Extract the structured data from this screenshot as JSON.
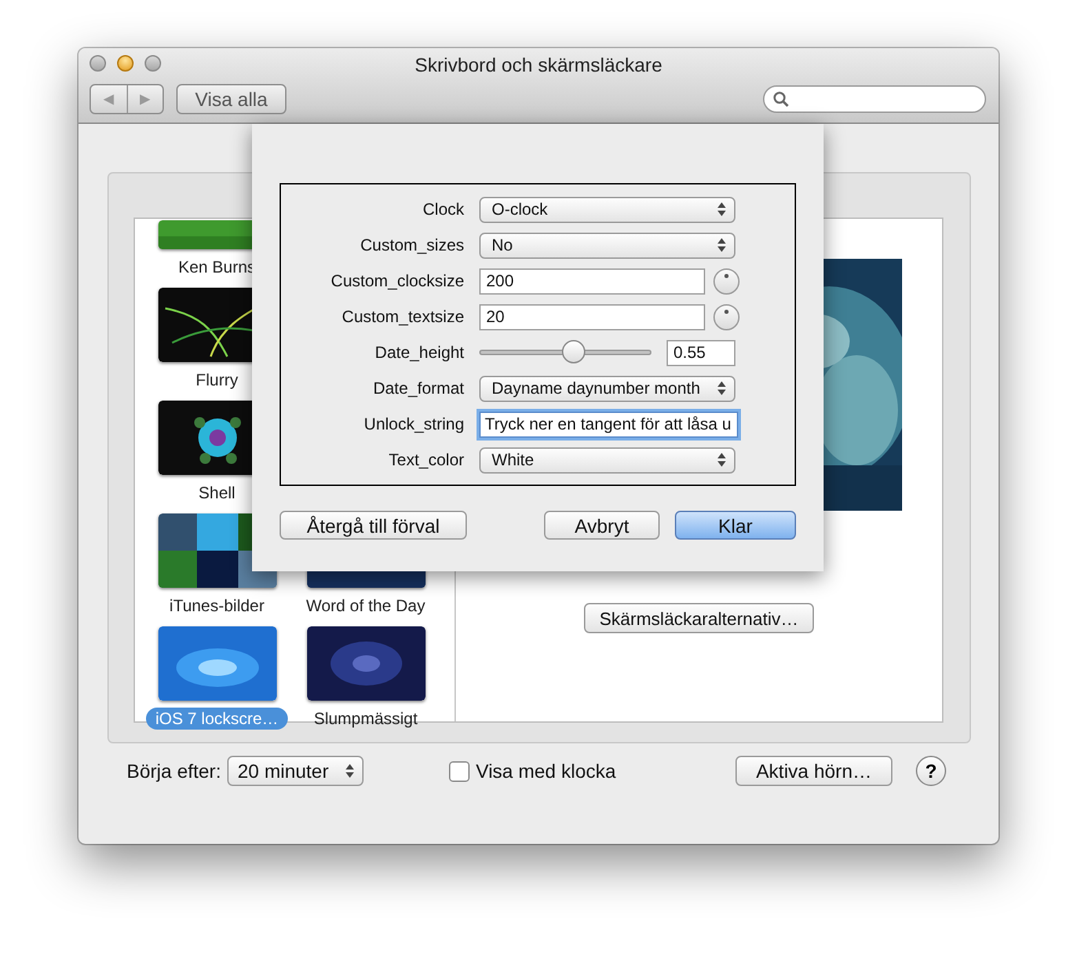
{
  "window": {
    "title": "Skrivbord och skärmsläckare"
  },
  "toolbar": {
    "back": "◀",
    "forward": "▶",
    "show_all": "Visa alla"
  },
  "screensavers": [
    {
      "name": "Ken Burns",
      "selected": false
    },
    {
      "name": "Flurry",
      "selected": false
    },
    {
      "name": "Shell",
      "selected": false
    },
    {
      "name": "iTunes-bilder",
      "selected": false
    },
    {
      "name": "Word of the Day",
      "selected": false
    },
    {
      "name": "iOS 7 lockscre…",
      "selected": true
    },
    {
      "name": "Slumpmässigt",
      "selected": false
    }
  ],
  "options_button": "Skärmsläckaralternativ…",
  "sheet": {
    "options": [
      {
        "kind": "popup",
        "label": "Clock",
        "value": "O-clock"
      },
      {
        "kind": "popup",
        "label": "Custom_sizes",
        "value": "No"
      },
      {
        "kind": "number",
        "label": "Custom_clocksize",
        "value": "200"
      },
      {
        "kind": "number",
        "label": "Custom_textsize",
        "value": "20"
      },
      {
        "kind": "slider",
        "label": "Date_height",
        "level": 0.55,
        "reading": "0.55"
      },
      {
        "kind": "popup",
        "label": "Date_format",
        "value": "Dayname daynumber month"
      },
      {
        "kind": "text",
        "label": "Unlock_string",
        "value": "Tryck ner en tangent för att låsa u"
      },
      {
        "kind": "popup",
        "label": "Text_color",
        "value": "White"
      }
    ],
    "buttons": [
      {
        "label": "Återgå till förval",
        "default": false
      },
      {
        "label": "Avbryt",
        "default": false
      },
      {
        "label": "Klar",
        "default": true
      }
    ]
  },
  "bottom": {
    "start_after_label": "Börja efter:",
    "start_after": "20 minuter",
    "show_clock": {
      "label": "Visa med klocka",
      "checked": false
    },
    "hot_corners": "Aktiva hörn…",
    "help": "?"
  }
}
